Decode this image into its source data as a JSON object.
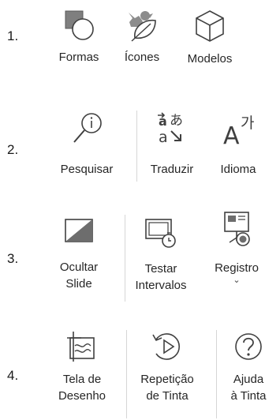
{
  "rows": [
    {
      "number": "1.",
      "buttons": [
        {
          "label": "Formas"
        },
        {
          "label": "Ícones"
        },
        {
          "label": "Modelos"
        }
      ]
    },
    {
      "number": "2.",
      "buttons": [
        {
          "label": "Pesquisar"
        },
        {
          "label": "Traduzir"
        },
        {
          "label": "Idioma"
        }
      ]
    },
    {
      "number": "3.",
      "buttons": [
        {
          "line1": "Ocultar",
          "line2": "Slide"
        },
        {
          "line1": "Testar",
          "line2": "Intervalos"
        },
        {
          "label": "Registro",
          "caret": "⌄"
        }
      ]
    },
    {
      "number": "4.",
      "buttons": [
        {
          "line1": "Tela de",
          "line2": "Desenho"
        },
        {
          "line1": "Repetição",
          "line2": "de Tinta"
        },
        {
          "line1": "Ajuda",
          "line2": "à Tinta"
        }
      ]
    }
  ]
}
